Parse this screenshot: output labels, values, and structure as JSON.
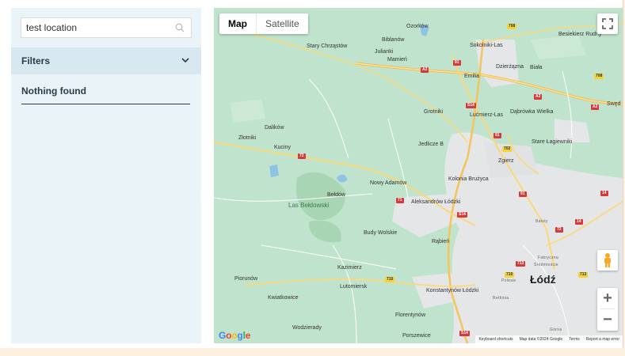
{
  "search": {
    "value": "test location"
  },
  "filters": {
    "label": "Filters"
  },
  "results": {
    "empty_text": "Nothing found"
  },
  "map": {
    "type_buttons": [
      "Map",
      "Satellite"
    ],
    "active_type": "Map",
    "zoom_in": "+",
    "zoom_out": "−",
    "places": [
      {
        "name": "Ozorków"
      },
      {
        "name": "Biblanów"
      },
      {
        "name": "Sokolniki-Las"
      },
      {
        "name": "Besiekierz Rudny"
      },
      {
        "name": "Stary Chrząstów"
      },
      {
        "name": "Julianki"
      },
      {
        "name": "Mamień"
      },
      {
        "name": "Emilia"
      },
      {
        "name": "Dzierżązna"
      },
      {
        "name": "Biała"
      },
      {
        "name": "Swęd"
      },
      {
        "name": "Grotniki"
      },
      {
        "name": "Lućmierz-Las"
      },
      {
        "name": "Dąbrówka Wielka"
      },
      {
        "name": "Dalików"
      },
      {
        "name": "Złotniki"
      },
      {
        "name": "Kuciny"
      },
      {
        "name": "Jedlicze B"
      },
      {
        "name": "Stare Łagiewniki"
      },
      {
        "name": "Zgierz"
      },
      {
        "name": "Nowy Adamów"
      },
      {
        "name": "Kolonia Brużyca"
      },
      {
        "name": "Bełdów"
      },
      {
        "name": "Aleksandrów Łódzki"
      },
      {
        "name": "Bałuty"
      },
      {
        "name": "Budy Wolskie"
      },
      {
        "name": "Rąbień"
      },
      {
        "name": "Piorunów"
      },
      {
        "name": "Kazimierz"
      },
      {
        "name": "Kwiatkowice"
      },
      {
        "name": "Lutomiersk"
      },
      {
        "name": "Konstantynów Łódzki"
      },
      {
        "name": "Retkinia"
      },
      {
        "name": "Florentynów"
      },
      {
        "name": "Wodzierady"
      },
      {
        "name": "Porszewice"
      },
      {
        "name": "Fabryczna"
      },
      {
        "name": "Śródmieście"
      },
      {
        "name": "Polesie"
      },
      {
        "name": "Górna"
      },
      {
        "name": "Łódź"
      },
      {
        "name": "Las Bełdowski"
      }
    ],
    "roads": [
      "708",
      "A2",
      "91",
      "S14",
      "702",
      "72",
      "71",
      "91",
      "710",
      "713",
      "14",
      "72",
      "14",
      "708",
      "A2",
      "A2",
      "S14",
      "91",
      "713",
      "710",
      "S14"
    ],
    "attribution": {
      "logo": "Google",
      "shortcuts": "Keyboard shortcuts",
      "data": "Map data ©2024 Google",
      "terms": "Terms",
      "report": "Report a map error"
    }
  }
}
